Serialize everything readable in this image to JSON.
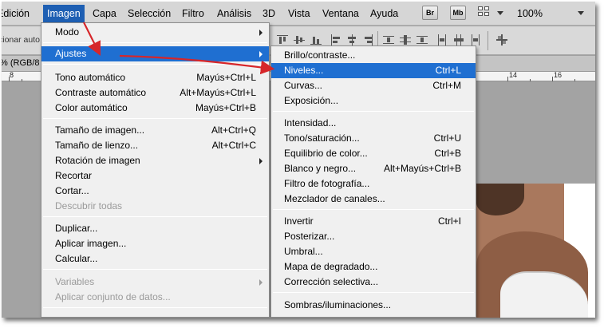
{
  "menubar": {
    "items": [
      "Edición",
      "Imagen",
      "Capa",
      "Selección",
      "Filtro",
      "Análisis",
      "3D",
      "Vista",
      "Ventana",
      "Ayuda"
    ],
    "active": "Imagen",
    "bridge_button": "Br",
    "minibridge_button": "Mb",
    "zoom": "100%"
  },
  "optionsbar": {
    "select_text": "cionar auto"
  },
  "document": {
    "tab_text": "% (RGB/8",
    "ruler_left": "8",
    "ruler_right1": "14",
    "ruler_right2": "16"
  },
  "imagen_menu": {
    "items": [
      {
        "label": "Modo",
        "shortcut": "",
        "submenu": true
      },
      {
        "label": "Ajustes",
        "shortcut": "",
        "submenu": true,
        "highlighted": true
      },
      {
        "label": "Tono automático",
        "shortcut": "Mayús+Ctrl+L"
      },
      {
        "label": "Contraste automático",
        "shortcut": "Alt+Mayús+Ctrl+L"
      },
      {
        "label": "Color automático",
        "shortcut": "Mayús+Ctrl+B"
      },
      {
        "label": "Tamaño de imagen...",
        "shortcut": "Alt+Ctrl+Q"
      },
      {
        "label": "Tamaño de lienzo...",
        "shortcut": "Alt+Ctrl+C"
      },
      {
        "label": "Rotación de imagen",
        "shortcut": "",
        "submenu": true
      },
      {
        "label": "Recortar",
        "shortcut": ""
      },
      {
        "label": "Cortar...",
        "shortcut": ""
      },
      {
        "label": "Descubrir todas",
        "shortcut": "",
        "disabled": true
      },
      {
        "label": "Duplicar...",
        "shortcut": ""
      },
      {
        "label": "Aplicar imagen...",
        "shortcut": ""
      },
      {
        "label": "Calcular...",
        "shortcut": ""
      },
      {
        "label": "Variables",
        "shortcut": "",
        "submenu": true,
        "disabled": true
      },
      {
        "label": "Aplicar conjunto de datos...",
        "shortcut": "",
        "disabled": true
      }
    ]
  },
  "ajustes_menu": {
    "items": [
      {
        "label": "Brillo/contraste...",
        "shortcut": ""
      },
      {
        "label": "Niveles...",
        "shortcut": "Ctrl+L",
        "highlighted": true
      },
      {
        "label": "Curvas...",
        "shortcut": "Ctrl+M"
      },
      {
        "label": "Exposición...",
        "shortcut": ""
      },
      {
        "label": "Intensidad...",
        "shortcut": ""
      },
      {
        "label": "Tono/saturación...",
        "shortcut": "Ctrl+U"
      },
      {
        "label": "Equilibrio de color...",
        "shortcut": "Ctrl+B"
      },
      {
        "label": "Blanco y negro...",
        "shortcut": "Alt+Mayús+Ctrl+B"
      },
      {
        "label": "Filtro de fotografía...",
        "shortcut": ""
      },
      {
        "label": "Mezclador de canales...",
        "shortcut": ""
      },
      {
        "label": "Invertir",
        "shortcut": "Ctrl+I"
      },
      {
        "label": "Posterizar...",
        "shortcut": ""
      },
      {
        "label": "Umbral...",
        "shortcut": ""
      },
      {
        "label": "Mapa de degradado...",
        "shortcut": ""
      },
      {
        "label": "Corrección selectiva...",
        "shortcut": ""
      },
      {
        "label": "Sombras/iluminaciones...",
        "shortcut": ""
      }
    ]
  },
  "colors": {
    "highlight": "#1f6fd1",
    "annotation_arrow": "#d6262a"
  }
}
